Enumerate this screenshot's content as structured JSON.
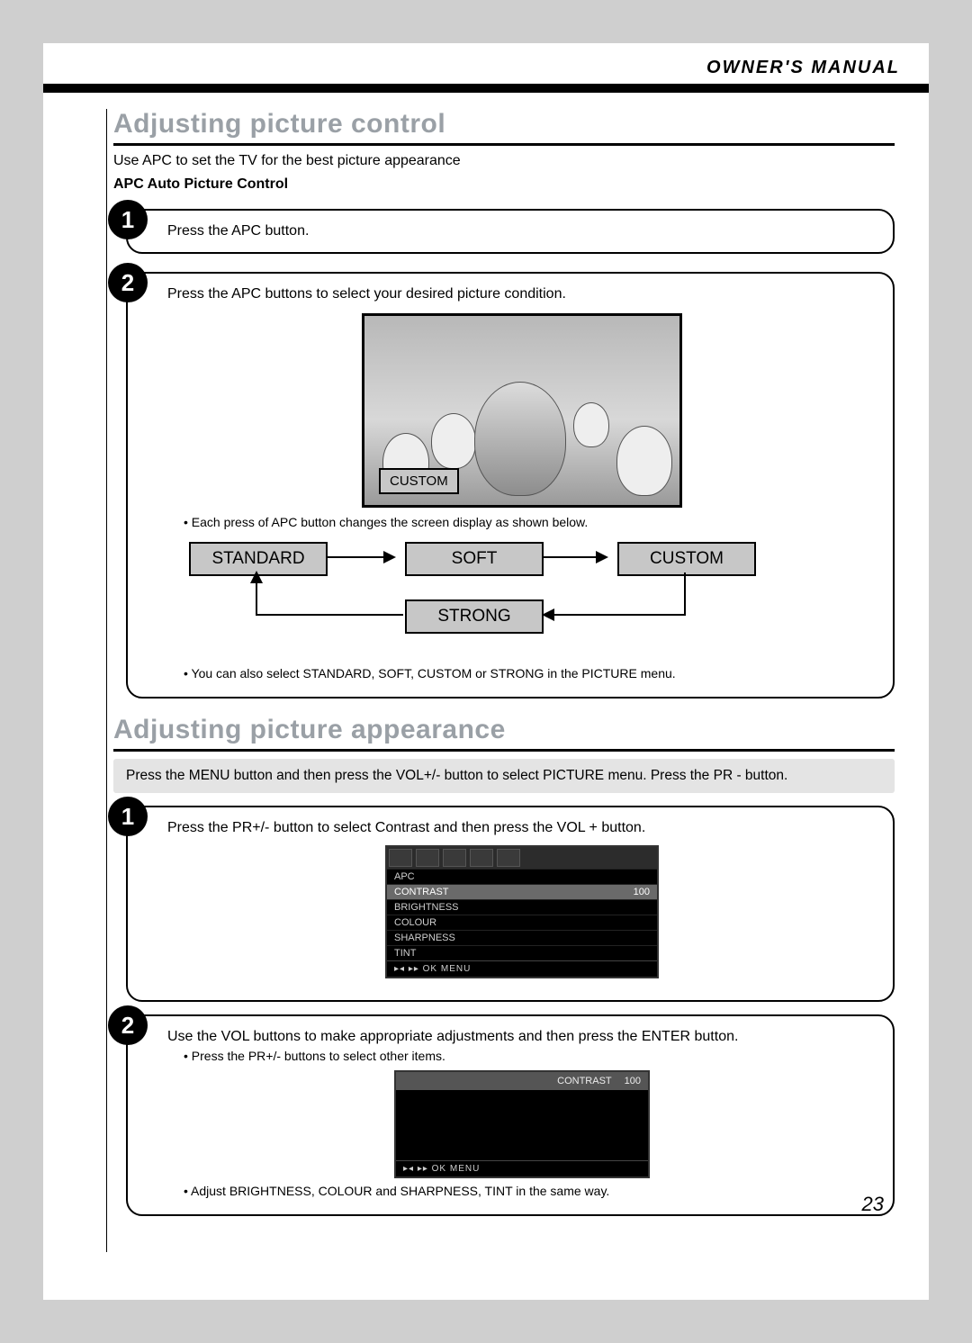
{
  "header": {
    "title": "OWNER'S MANUAL"
  },
  "section1": {
    "title": "Adjusting picture control",
    "intro": "Use APC to set the TV for the best picture appearance",
    "sub": "APC Auto Picture Control",
    "step1": {
      "num": "1",
      "text": "Press the APC button."
    },
    "step2": {
      "num": "2",
      "text": "Press the APC buttons to select your desired picture condition.",
      "chip": "CUSTOM",
      "note1": "Each press of APC button changes the screen display as shown below.",
      "nodes": {
        "standard": "STANDARD",
        "soft": "SOFT",
        "custom": "CUSTOM",
        "strong": "STRONG"
      },
      "note2": "You can also select STANDARD, SOFT, CUSTOM or STRONG in the PICTURE menu."
    }
  },
  "section2": {
    "title": "Adjusting picture appearance",
    "bar": "Press the MENU button and then press the VOL+/- button to select PICTURE menu. Press the PR - button.",
    "step1": {
      "num": "1",
      "text": "Press the PR+/- button to select Contrast and then press the VOL + button.",
      "osd": {
        "rows": [
          "APC",
          "CONTRAST",
          "BRIGHTNESS",
          "COLOUR",
          "SHARPNESS",
          "TINT"
        ],
        "selected": 1,
        "value": "100",
        "foot": "▸◂ ▸▸  OK  MENU"
      }
    },
    "step2": {
      "num": "2",
      "text": "Use the VOL buttons to make appropriate adjustments and then press the ENTER button.",
      "line2": "Press the PR+/- buttons to select other items.",
      "osd": {
        "label": "CONTRAST",
        "value": "100",
        "foot": "▸◂ ▸▸  OK  MENU"
      },
      "line3": "Adjust BRIGHTNESS, COLOUR and SHARPNESS, TINT in the same way."
    }
  },
  "page": "23"
}
